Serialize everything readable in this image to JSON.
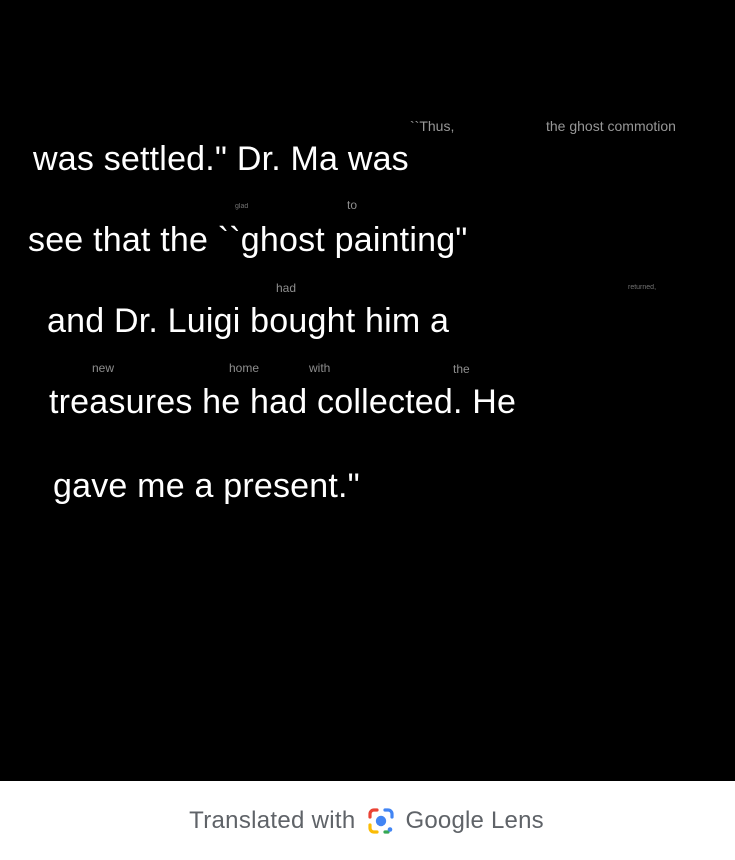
{
  "translation": {
    "main_lines": [
      "was settled.\" Dr. Ma was",
      "see that the ``ghost painting\"",
      "and Dr. Luigi bought him a",
      "treasures he had collected. He",
      "gave me a present.\""
    ],
    "small_words": [
      "``Thus,",
      "the ghost commotion",
      "glad",
      "to",
      "had",
      "returned,",
      "new",
      "home",
      "with",
      "the"
    ]
  },
  "footer": {
    "prefix": "Translated with",
    "brand": "Google Lens",
    "icon": "google-lens-icon"
  },
  "colors": {
    "background": "#000000",
    "text": "#ffffff",
    "faded_text": "#bdbdbd",
    "footer_bg": "#ffffff",
    "footer_text": "#5f6368",
    "lens_blue": "#4285F4",
    "lens_red": "#EA4335",
    "lens_yellow": "#FBBC05",
    "lens_green": "#34A853"
  }
}
